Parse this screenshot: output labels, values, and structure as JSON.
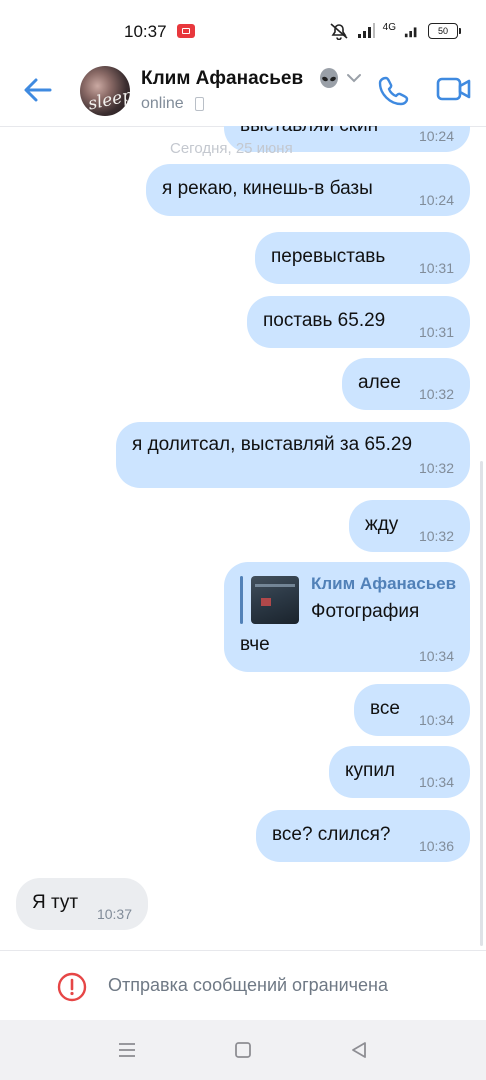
{
  "status_bar": {
    "time": "10:37",
    "network_label": "4G",
    "battery": "50",
    "icons": [
      "screen-record-icon",
      "mute-icon",
      "signal-icon",
      "wifi-icon",
      "battery-icon"
    ]
  },
  "header": {
    "contact_name": "Клим Афанасьев",
    "status": "online",
    "avatar_text": "sleep",
    "icons": [
      "back-arrow-icon",
      "alien-emoji-icon",
      "chevron-down-icon",
      "phone-icon",
      "video-camera-icon"
    ]
  },
  "chat": {
    "partial_message": {
      "text": "выставляи скин",
      "time": "10:24"
    },
    "date_separator": "Сегодня, 25 июня",
    "messages": [
      {
        "text": "я рекаю, кинешь-в базы",
        "time": "10:24",
        "direction": "out"
      },
      {
        "text": "перевыставь",
        "time": "10:31",
        "direction": "out"
      },
      {
        "text": "поставь 65.29",
        "time": "10:31",
        "direction": "out"
      },
      {
        "text": "алее",
        "time": "10:32",
        "direction": "out"
      },
      {
        "text": "я долитсал, выставляй за 65.29",
        "time": "10:32",
        "direction": "out"
      },
      {
        "text": "жду",
        "time": "10:32",
        "direction": "out"
      },
      {
        "reply": {
          "author": "Клим Афанасьев",
          "snippet": "Фотография"
        },
        "text": "вче",
        "time": "10:34",
        "direction": "out"
      },
      {
        "text": "все",
        "time": "10:34",
        "direction": "out"
      },
      {
        "text": "купил",
        "time": "10:34",
        "direction": "out"
      },
      {
        "text": "все? слился?",
        "time": "10:36",
        "direction": "out"
      },
      {
        "text": "Я тут",
        "time": "10:37",
        "direction": "in"
      }
    ]
  },
  "footer": {
    "restriction_text": "Отправка сообщений ограничена",
    "icon": "alert-circle-icon"
  },
  "system_nav": {
    "icons": [
      "menu-icon",
      "home-icon",
      "back-icon"
    ]
  },
  "colors": {
    "accent": "#3f8ae0",
    "outgoing_bubble": "#cce4ff",
    "incoming_bubble": "#ebedf0",
    "muted_text": "#818c99",
    "alert": "#e64646"
  }
}
